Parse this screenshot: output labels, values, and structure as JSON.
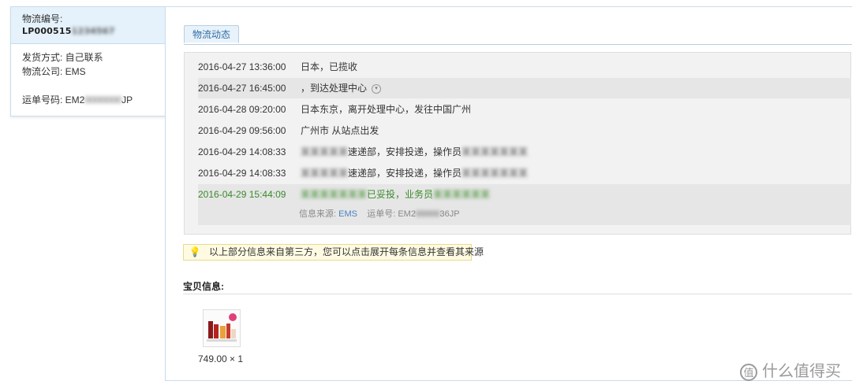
{
  "left": {
    "logistics_no_label": "物流编号:",
    "logistics_no": "LP000515",
    "ship_method": "发货方式: 自己联系",
    "company": "物流公司: EMS",
    "waybill_label": "运单号码: EM2",
    "waybill_tail": "JP"
  },
  "tab": {
    "label": "物流动态"
  },
  "tracking": [
    {
      "time": "2016-04-27 13:36:00",
      "event": "日本，已揽收"
    },
    {
      "time": "2016-04-27 16:45:00",
      "event": "，到达处理中心"
    },
    {
      "time": "2016-04-28 09:20:00",
      "event": "日本东京，离开处理中心，发往中国广州"
    },
    {
      "time": "2016-04-29 09:56:00",
      "event": "广州市 从站点出发"
    },
    {
      "time": "2016-04-29 14:08:33",
      "event": "速递部，安排投递，操作员"
    },
    {
      "time": "2016-04-29 14:08:33",
      "event": "速递部，安排投递，操作员"
    },
    {
      "time": "2016-04-29 15:44:09",
      "event": "已妥投，业务员"
    }
  ],
  "source": {
    "label": "信息来源:",
    "value": "EMS",
    "waybill_label": "运单号: EM2",
    "waybill_tail": "36JP"
  },
  "notice": {
    "text": "以上部分信息来自第三方，您可以点击展开每条信息并查看其来源"
  },
  "goods": {
    "title": "宝贝信息:",
    "price": "749.00 × 1"
  },
  "watermark": {
    "icon": "值",
    "text": "什么值得买"
  }
}
